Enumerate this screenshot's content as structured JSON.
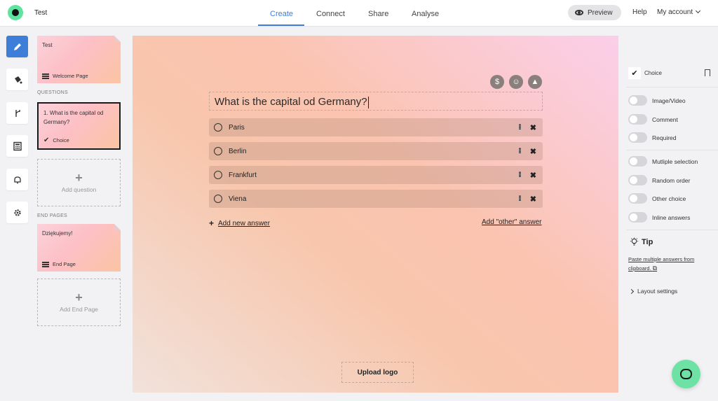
{
  "app": {
    "title": "Test"
  },
  "nav": {
    "tabs": [
      {
        "label": "Create",
        "active": true
      },
      {
        "label": "Connect"
      },
      {
        "label": "Share"
      },
      {
        "label": "Analyse"
      }
    ],
    "preview_label": "Preview",
    "help_label": "Help",
    "account_label": "My account"
  },
  "rail": {
    "items": [
      "pencil-icon",
      "paint-bucket-icon",
      "branch-icon",
      "calculator-icon",
      "bell-icon",
      "gear-icon"
    ]
  },
  "pages": {
    "welcome": {
      "title": "Test",
      "type": "Welcome Page"
    },
    "questions_label": "QUESTIONS",
    "question_card": {
      "title": "1. What is the capital od Germany?",
      "type": "Choice"
    },
    "add_question_label": "Add question",
    "end_pages_label": "END PAGES",
    "end_card": {
      "title": "Dziękujemy!",
      "type": "End Page"
    },
    "add_end_page_label": "Add End Page"
  },
  "editor": {
    "question": "What is the capital od Germany?",
    "answers": [
      "Paris",
      "Berlin",
      "Frankfurt",
      "Viena"
    ],
    "add_answer_label": "Add new answer",
    "add_other_label": "Add \"other\" answer",
    "upload_logo_label": "Upload logo",
    "icons": [
      "dollar-icon",
      "smile-icon",
      "image-icon"
    ]
  },
  "settings": {
    "question_type": "Choice",
    "toggles": [
      {
        "label": "Image/Video",
        "on": false
      },
      {
        "label": "Comment",
        "on": false
      },
      {
        "label": "Required",
        "on": false
      },
      {
        "label": "Mutliple selection",
        "on": false
      },
      {
        "label": "Random order",
        "on": false
      },
      {
        "label": "Other choice",
        "on": false
      },
      {
        "label": "Inline answers",
        "on": false
      }
    ],
    "tip_title": "Tip",
    "tip_text": "Paste multiple answers from clipboard.",
    "layout_label": "Layout settings"
  },
  "colors": {
    "accent": "#3f7ed8",
    "brand": "#5fe4a0"
  }
}
